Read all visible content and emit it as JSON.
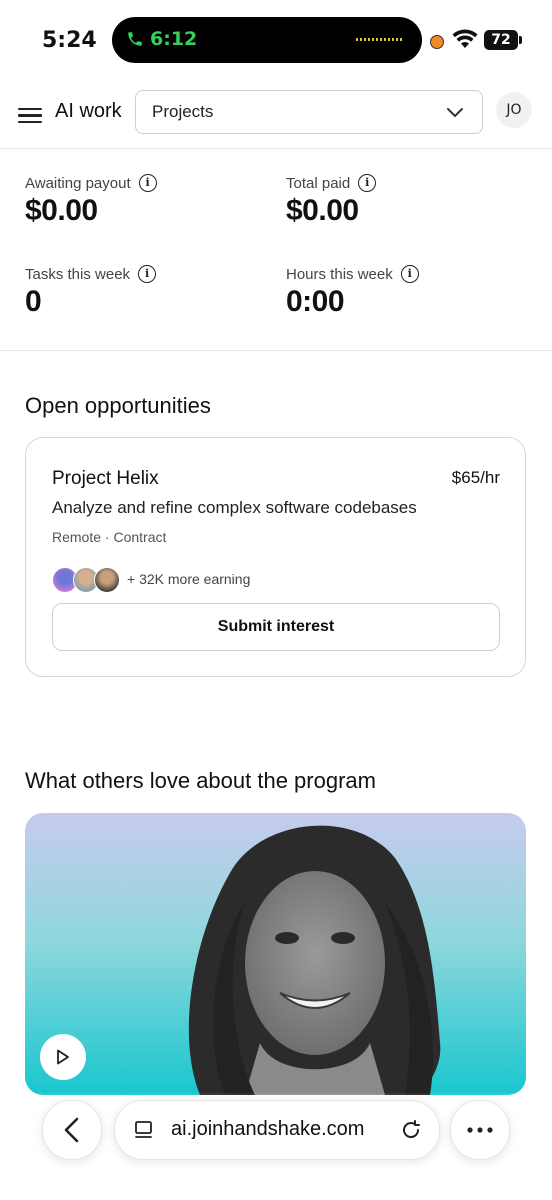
{
  "status_bar": {
    "time": "5:24",
    "call_time": "6:12",
    "battery": "72",
    "colors": {
      "call_green": "#36d05b",
      "recording_dot": "#f08a24"
    }
  },
  "header": {
    "app_title": "AI work",
    "menu_icon": "hamburger-icon",
    "select_value": "Projects",
    "avatar_initials": "JO"
  },
  "stats": [
    {
      "label": "Awaiting payout",
      "value": "$0.00"
    },
    {
      "label": "Total paid",
      "value": "$0.00"
    },
    {
      "label": "Tasks this week",
      "value": "0"
    },
    {
      "label": "Hours this week",
      "value": "0:00"
    }
  ],
  "opportunities": {
    "title": "Open opportunities",
    "card": {
      "project": "Project Helix",
      "rate": "$65/hr",
      "description": "Analyze and refine complex software codebases",
      "meta": "Remote · Contract",
      "earning": "+ 32K more earning",
      "button": "Submit interest"
    }
  },
  "testimonials": {
    "title": "What others love about the program"
  },
  "browser": {
    "url": "ai.joinhandshake.com"
  }
}
